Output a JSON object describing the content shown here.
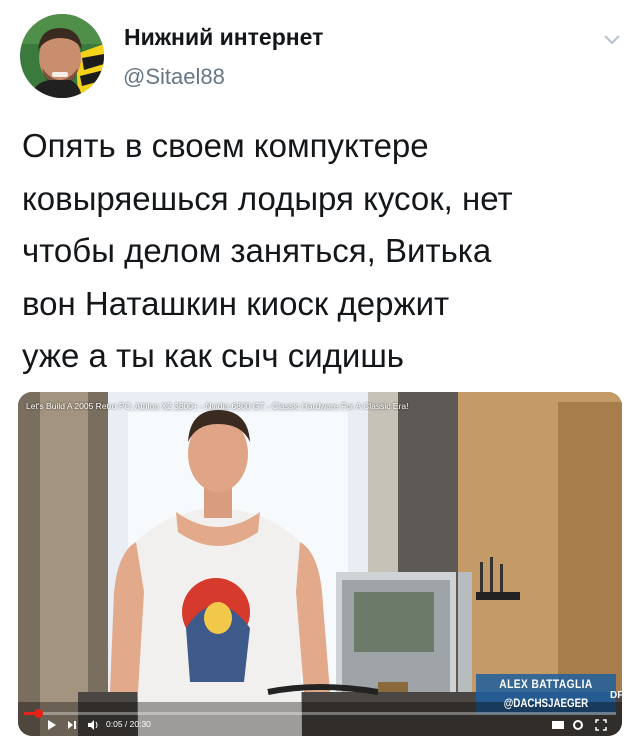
{
  "author": {
    "name": "Нижний интернет",
    "handle": "@Sitael88",
    "avatar_icon": "avatar-photo"
  },
  "tweet": {
    "text": "Опять в своем компуктере\nковыряешься лодыря кусок, нет\nчтобы делом заняться, Витька\nвон Наташкин киоск держит\nуже а ты как сыч сидишь"
  },
  "media": {
    "video_title": "Let's Build A 2005 Retro PC: Athlon X2 3800+ - Nvidia 6800 GT - Classic Hardware For A Classic Era!",
    "watermark_name": "ALEX BATTAGLIA",
    "watermark_handle": "@DACHSJAEGER",
    "logo_text": "DF",
    "player": {
      "current_time": "0:05",
      "duration": "20:30",
      "progress_fraction": 0.004
    }
  },
  "icons": {
    "caret": "chevron-down-icon",
    "play": "play-icon",
    "next": "next-icon",
    "volume": "volume-icon",
    "cc": "captions-icon",
    "settings": "gear-icon",
    "fullscreen": "fullscreen-icon"
  },
  "colors": {
    "name": "#14171a",
    "handle": "#657786",
    "progress": "#e62117"
  }
}
